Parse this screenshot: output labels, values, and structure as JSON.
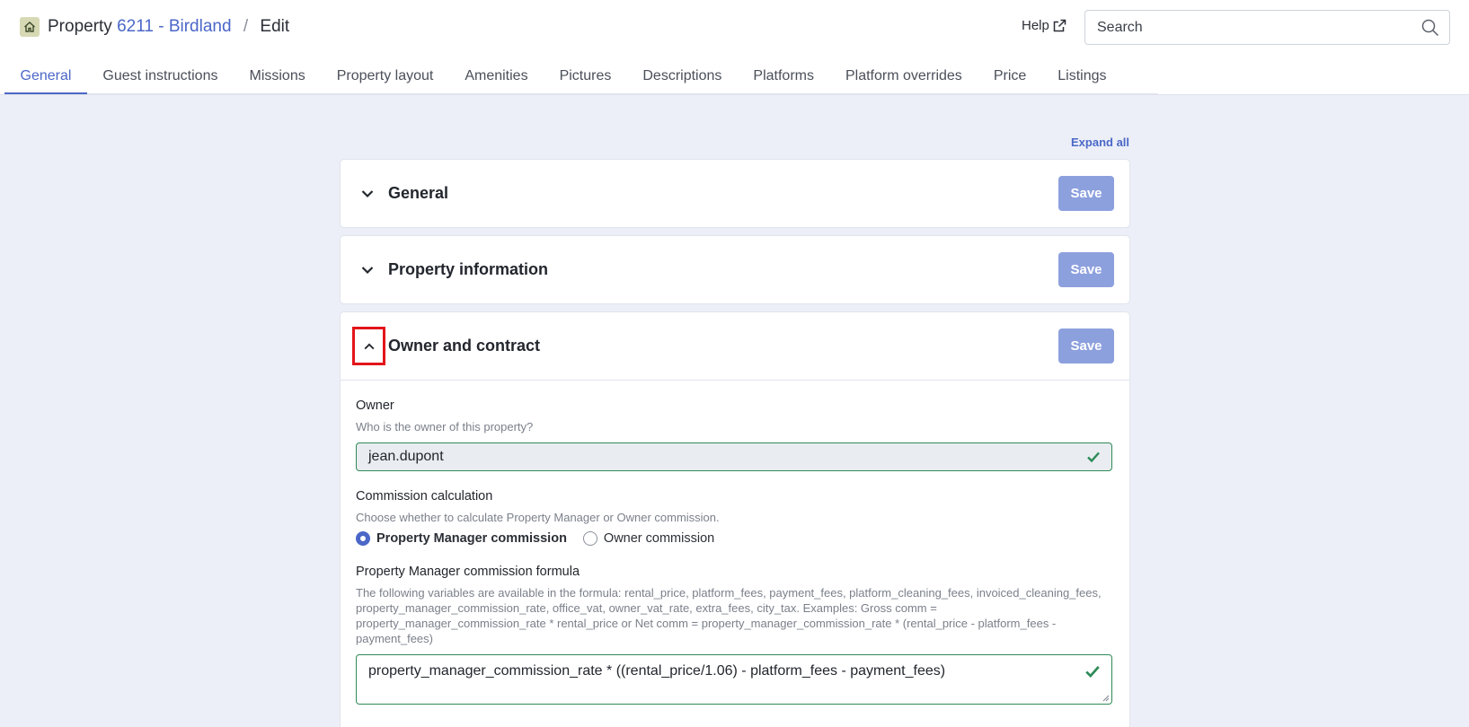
{
  "header": {
    "breadcrumb": {
      "prefix": "Property",
      "property_link": "6211 - Birdland",
      "separator": "/",
      "current": "Edit"
    },
    "help_label": "Help",
    "search_placeholder": "Search"
  },
  "tabs": [
    {
      "label": "General",
      "active": true
    },
    {
      "label": "Guest instructions"
    },
    {
      "label": "Missions"
    },
    {
      "label": "Property layout"
    },
    {
      "label": "Amenities"
    },
    {
      "label": "Pictures"
    },
    {
      "label": "Descriptions"
    },
    {
      "label": "Platforms"
    },
    {
      "label": "Platform overrides"
    },
    {
      "label": "Price"
    },
    {
      "label": "Listings"
    }
  ],
  "expand_all_label": "Expand all",
  "sections": [
    {
      "title": "General",
      "save_label": "Save",
      "expanded": false
    },
    {
      "title": "Property information",
      "save_label": "Save",
      "expanded": false
    },
    {
      "title": "Owner and contract",
      "save_label": "Save",
      "expanded": true
    }
  ],
  "owner_section": {
    "owner": {
      "label": "Owner",
      "help": "Who is the owner of this property?",
      "value": "jean.dupont"
    },
    "commission": {
      "label": "Commission calculation",
      "help": "Choose whether to calculate Property Manager or Owner commission.",
      "options": [
        {
          "label": "Property Manager commission",
          "selected": true
        },
        {
          "label": "Owner commission",
          "selected": false
        }
      ]
    },
    "formula": {
      "label": "Property Manager commission formula",
      "help": "The following variables are available in the formula: rental_price, platform_fees, payment_fees, platform_cleaning_fees, invoiced_cleaning_fees, property_manager_commission_rate, office_vat, owner_vat_rate, extra_fees, city_tax. Examples: Gross comm = property_manager_commission_rate * rental_price or Net comm = property_manager_commission_rate * (rental_price - platform_fees - payment_fees)",
      "value": "property_manager_commission_rate * ((rental_price/1.06) - platform_fees - payment_fees)"
    }
  },
  "colors": {
    "accent": "#4b67c8",
    "save_button": "#8da0de",
    "valid": "#2e8b57",
    "highlight": "#e3151a"
  }
}
